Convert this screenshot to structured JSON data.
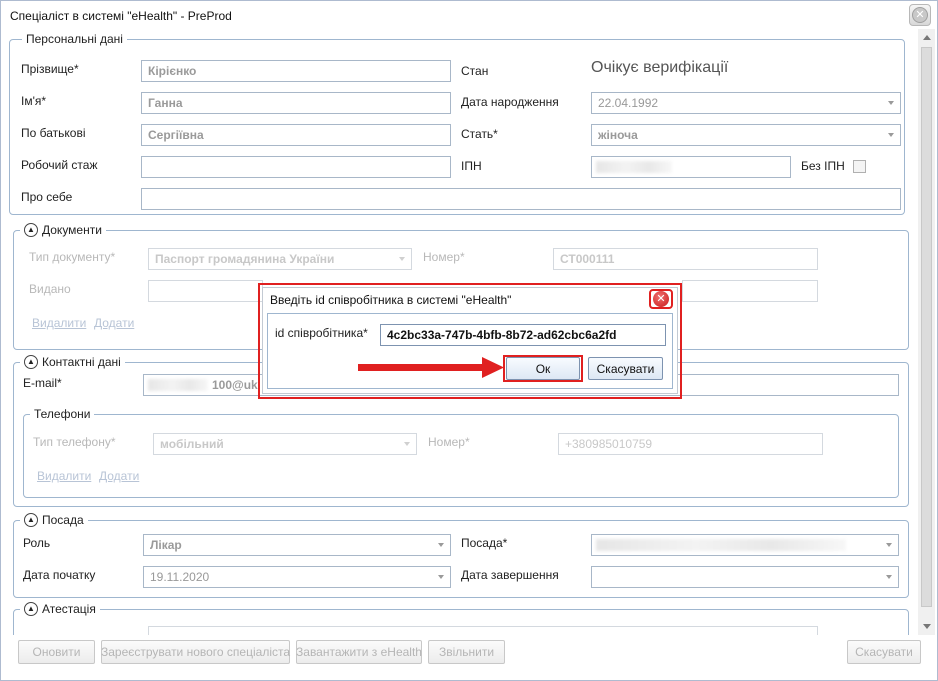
{
  "window": {
    "title": "Спеціаліст в системі \"eHealth\" - PreProd",
    "close_glyph": "✕"
  },
  "personal": {
    "legend": "Персональні дані",
    "surname_label": "Прізвище*",
    "surname_value": "Кірієнко",
    "name_label": "Ім'я*",
    "name_value": "Ганна",
    "patronymic_label": "По батькові",
    "patronymic_value": "Сергіївна",
    "experience_label": "Робочий стаж",
    "about_label": "Про себе",
    "state_label": "Стан",
    "state_value": "Очікує верифікації",
    "birth_label": "Дата народження",
    "birth_value": "22.04.1992",
    "gender_label": "Стать*",
    "gender_value": "жіноча",
    "ipn_label": "ІПН",
    "no_ipn_label": "Без ІПН"
  },
  "documents": {
    "legend": "Документи",
    "doc_type_label": "Тип документу*",
    "doc_type_value": "Паспорт громадянина України",
    "number_label": "Номер*",
    "number_value": "СТ000111",
    "issued_label": "Видано",
    "delete_link": "Видалити",
    "add_link": "Додати"
  },
  "contacts": {
    "legend": "Контактні дані",
    "email_label": "E-mail*",
    "email_value": "100@uk",
    "phones_legend": "Телефони",
    "phone_type_label": "Тип телефону*",
    "phone_type_value": "мобільний",
    "phone_number_label": "Номер*",
    "phone_number_value": "+380985010759",
    "delete_link": "Видалити",
    "add_link": "Додати"
  },
  "position": {
    "legend": "Посада",
    "role_label": "Роль",
    "role_value": "Лікар",
    "position_label": "Посада*",
    "start_label": "Дата початку",
    "start_value": "19.11.2020",
    "end_label": "Дата завершення"
  },
  "attestation": {
    "legend": "Атестація"
  },
  "buttons": {
    "update": "Оновити",
    "register": "Зареєструвати нового спеціаліста",
    "load": "Завантажити з eHealth",
    "dismiss": "Звільнити",
    "cancel": "Скасувати"
  },
  "dialog": {
    "title": "Введіть id співробітника в системі \"eHealth\"",
    "id_label": "id співробітника*",
    "id_value": "4c2bc33a-747b-4bfb-8b72-ad62cbc6a2fd",
    "ok": "Ок",
    "cancel": "Скасувати",
    "close_glyph": "✕"
  },
  "colors": {
    "highlight": "#e02020",
    "border": "#9fb6cf"
  }
}
